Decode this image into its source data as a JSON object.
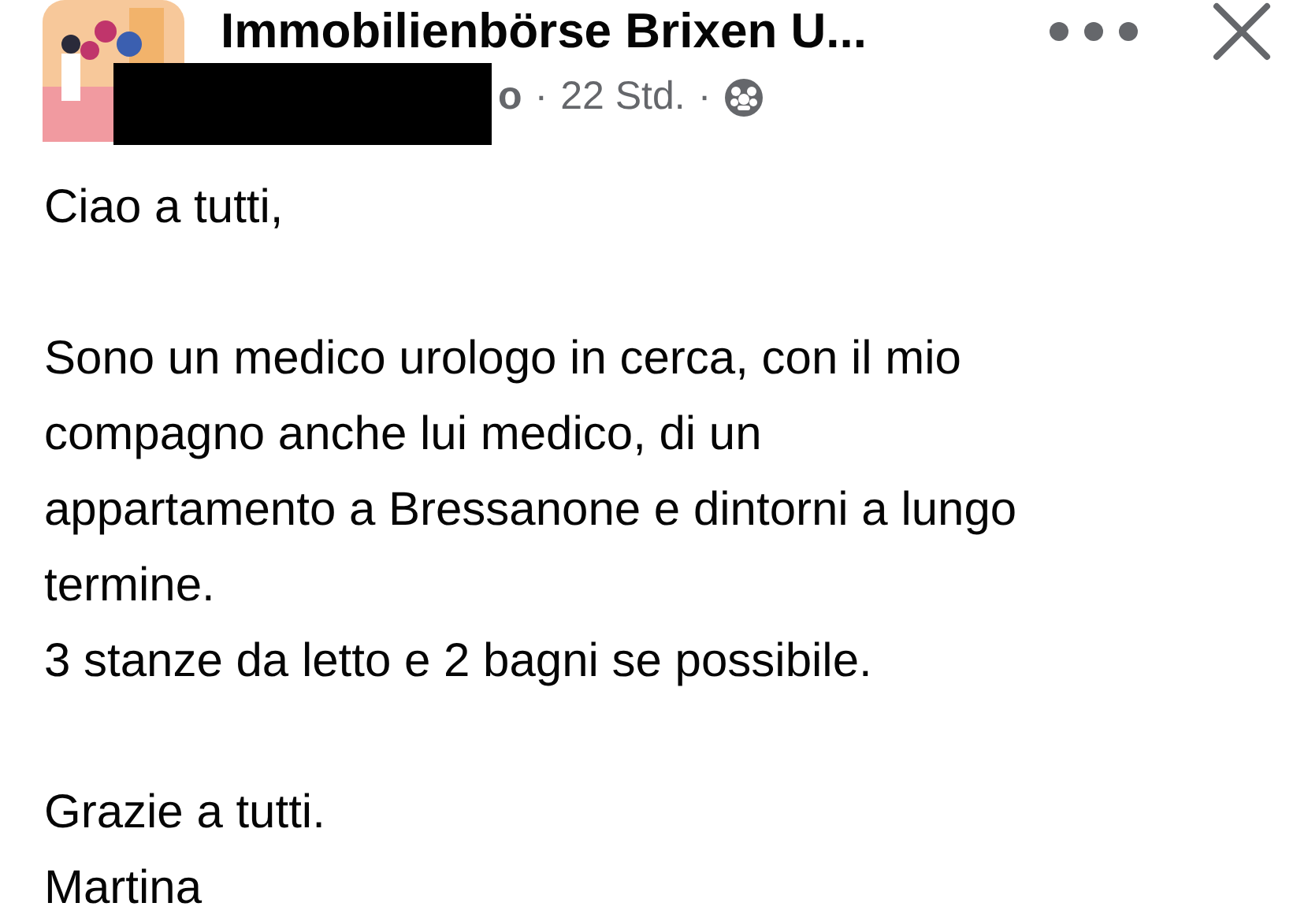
{
  "post": {
    "group_name": "Immobilienbörse Brixen U...",
    "author_fragment": "o",
    "time": "22 Std.",
    "separator": "·",
    "paragraphs": [
      {
        "lines": [
          "Ciao a tutti,"
        ]
      },
      {
        "lines": [
          "Sono un medico urologo in cerca, con il mio",
          "compagno anche lui medico, di un",
          "appartamento a Bressanone e dintorni a lungo",
          "termine.",
          "3 stanze da letto e 2 bagni se possibile."
        ]
      },
      {
        "lines": [
          "Grazie a tutti.",
          "Martina"
        ]
      }
    ]
  }
}
